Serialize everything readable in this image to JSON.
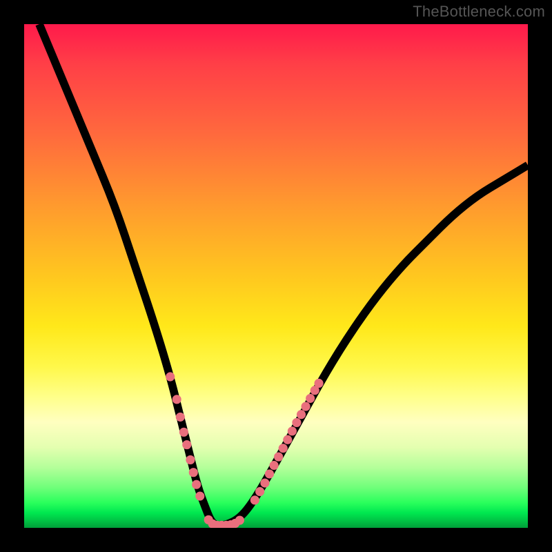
{
  "watermark": "TheBottleneck.com",
  "chart_data": {
    "type": "line",
    "title": "",
    "xlabel": "",
    "ylabel": "",
    "xlim": [
      0,
      100
    ],
    "ylim": [
      0,
      100
    ],
    "grid": false,
    "legend": false,
    "background_gradient": {
      "direction": "vertical",
      "stops": [
        {
          "pos": 0,
          "color": "#ff1a4b"
        },
        {
          "pos": 50,
          "color": "#ffe81a"
        },
        {
          "pos": 100,
          "color": "#009e3a"
        }
      ]
    },
    "series": [
      {
        "name": "curve",
        "x": [
          3,
          8,
          13,
          18,
          22,
          26,
          29,
          31,
          33,
          34.5,
          36,
          37,
          38,
          40,
          43,
          46,
          50,
          55,
          60,
          65,
          70,
          75,
          80,
          85,
          90,
          95,
          100
        ],
        "y": [
          100,
          88,
          76,
          64,
          52,
          40,
          30,
          22,
          14,
          8,
          4,
          1.5,
          0.5,
          0.5,
          2,
          6,
          13,
          22,
          31,
          39,
          46,
          52,
          57,
          62,
          66,
          69,
          72
        ]
      }
    ],
    "annotations": {
      "dots_left_branch": [
        {
          "x": 29.0,
          "y": 30.0
        },
        {
          "x": 30.3,
          "y": 25.5
        },
        {
          "x": 31.0,
          "y": 22.0
        },
        {
          "x": 31.7,
          "y": 19.0
        },
        {
          "x": 32.3,
          "y": 16.5
        },
        {
          "x": 33.0,
          "y": 13.5
        },
        {
          "x": 33.6,
          "y": 11.0
        },
        {
          "x": 34.2,
          "y": 8.6
        },
        {
          "x": 34.9,
          "y": 6.3
        }
      ],
      "dots_valley": [
        {
          "x": 36.6,
          "y": 1.6
        },
        {
          "x": 37.4,
          "y": 0.8
        },
        {
          "x": 38.3,
          "y": 0.5
        },
        {
          "x": 39.2,
          "y": 0.5
        },
        {
          "x": 40.1,
          "y": 0.5
        },
        {
          "x": 41.0,
          "y": 0.6
        },
        {
          "x": 41.9,
          "y": 0.9
        },
        {
          "x": 42.8,
          "y": 1.5
        }
      ],
      "dots_right_branch": [
        {
          "x": 45.8,
          "y": 5.5
        },
        {
          "x": 46.8,
          "y": 7.2
        },
        {
          "x": 47.8,
          "y": 8.9
        },
        {
          "x": 48.7,
          "y": 10.7
        },
        {
          "x": 49.6,
          "y": 12.4
        },
        {
          "x": 50.5,
          "y": 14.1
        },
        {
          "x": 51.4,
          "y": 15.8
        },
        {
          "x": 52.3,
          "y": 17.5
        },
        {
          "x": 53.2,
          "y": 19.2
        },
        {
          "x": 54.1,
          "y": 20.9
        },
        {
          "x": 55.0,
          "y": 22.5
        },
        {
          "x": 55.9,
          "y": 24.1
        },
        {
          "x": 56.8,
          "y": 25.7
        },
        {
          "x": 57.7,
          "y": 27.3
        },
        {
          "x": 58.5,
          "y": 28.7
        }
      ]
    }
  }
}
